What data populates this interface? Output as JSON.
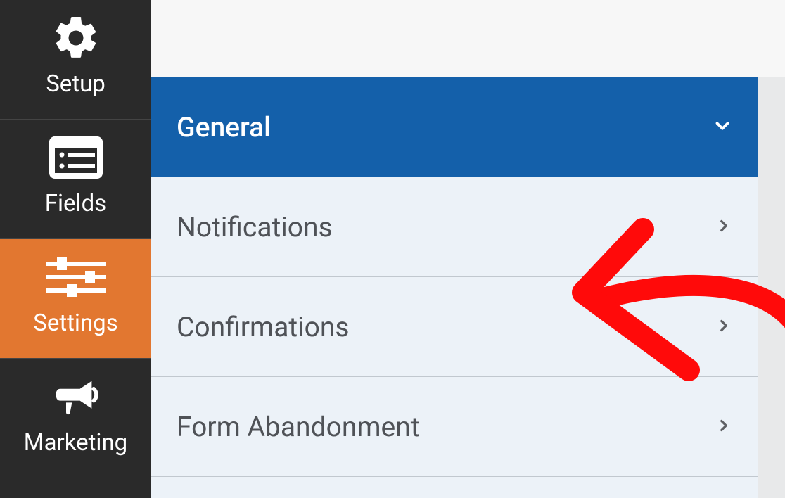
{
  "sidebar": {
    "items": [
      {
        "label": "Setup",
        "active": false
      },
      {
        "label": "Fields",
        "active": false
      },
      {
        "label": "Settings",
        "active": true
      },
      {
        "label": "Marketing",
        "active": false
      }
    ]
  },
  "settingsPanel": {
    "items": [
      {
        "label": "General",
        "expanded": true
      },
      {
        "label": "Notifications",
        "expanded": false
      },
      {
        "label": "Confirmations",
        "expanded": false
      },
      {
        "label": "Form Abandonment",
        "expanded": false
      }
    ]
  },
  "annotation": {
    "type": "arrow",
    "color": "#ff0000",
    "points_to": "Confirmations"
  }
}
